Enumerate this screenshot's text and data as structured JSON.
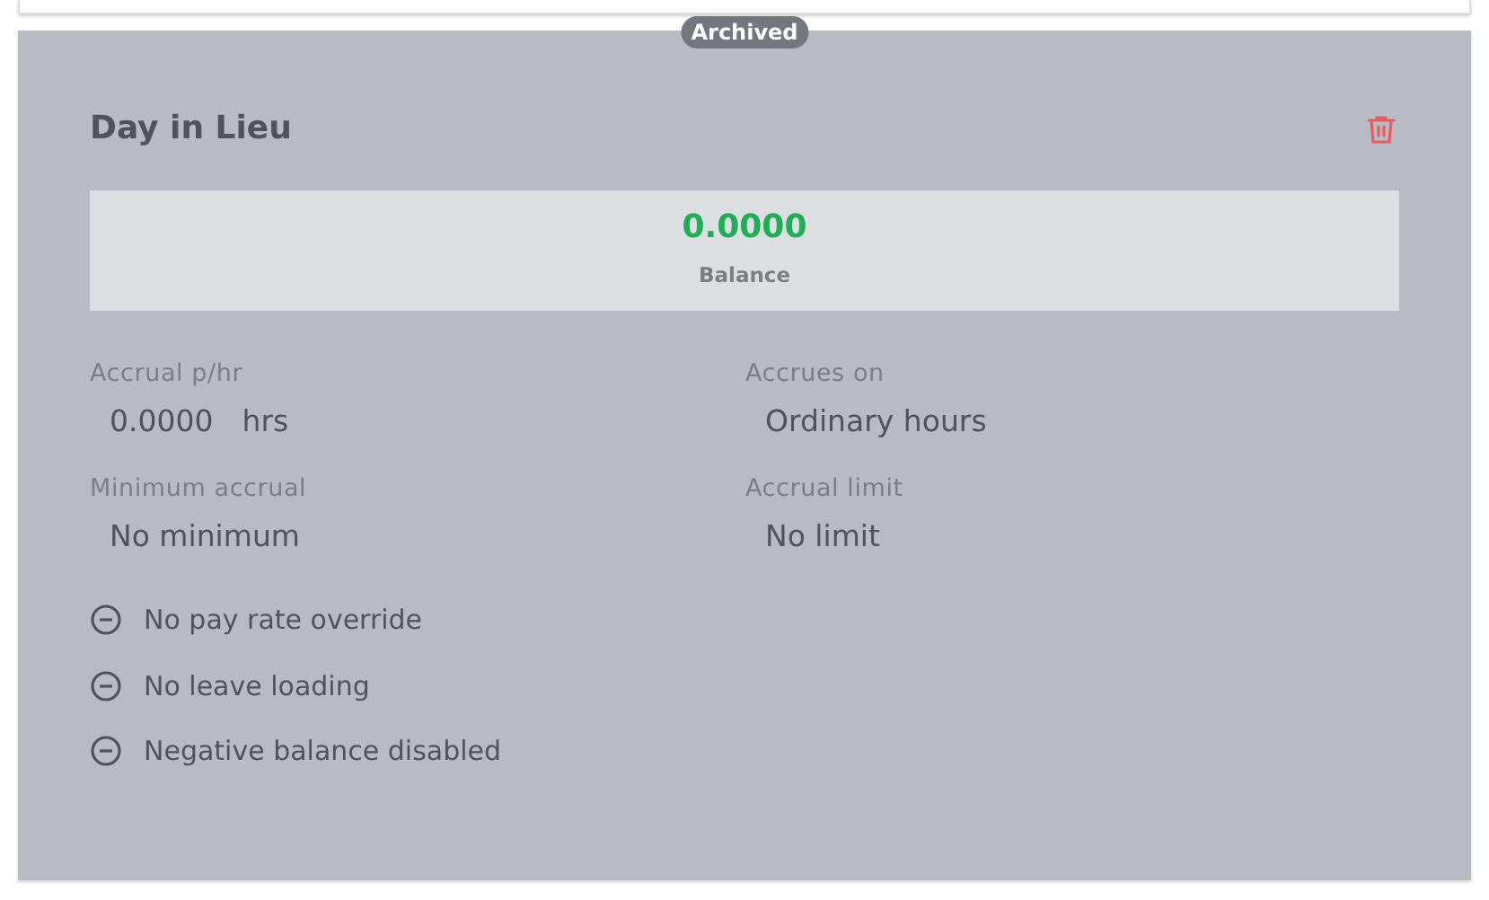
{
  "badge": "Archived",
  "title": "Day in Lieu",
  "balance": {
    "value": "0.0000",
    "label": "Balance"
  },
  "fields": [
    {
      "label": "Accrual p/hr",
      "value": "0.0000",
      "unit": "hrs"
    },
    {
      "label": "Accrues on",
      "value": "Ordinary hours"
    },
    {
      "label": "Minimum accrual",
      "value": "No minimum"
    },
    {
      "label": "Accrual limit",
      "value": "No limit"
    }
  ],
  "features": [
    "No pay rate override",
    "No leave loading",
    "Negative balance disabled"
  ]
}
